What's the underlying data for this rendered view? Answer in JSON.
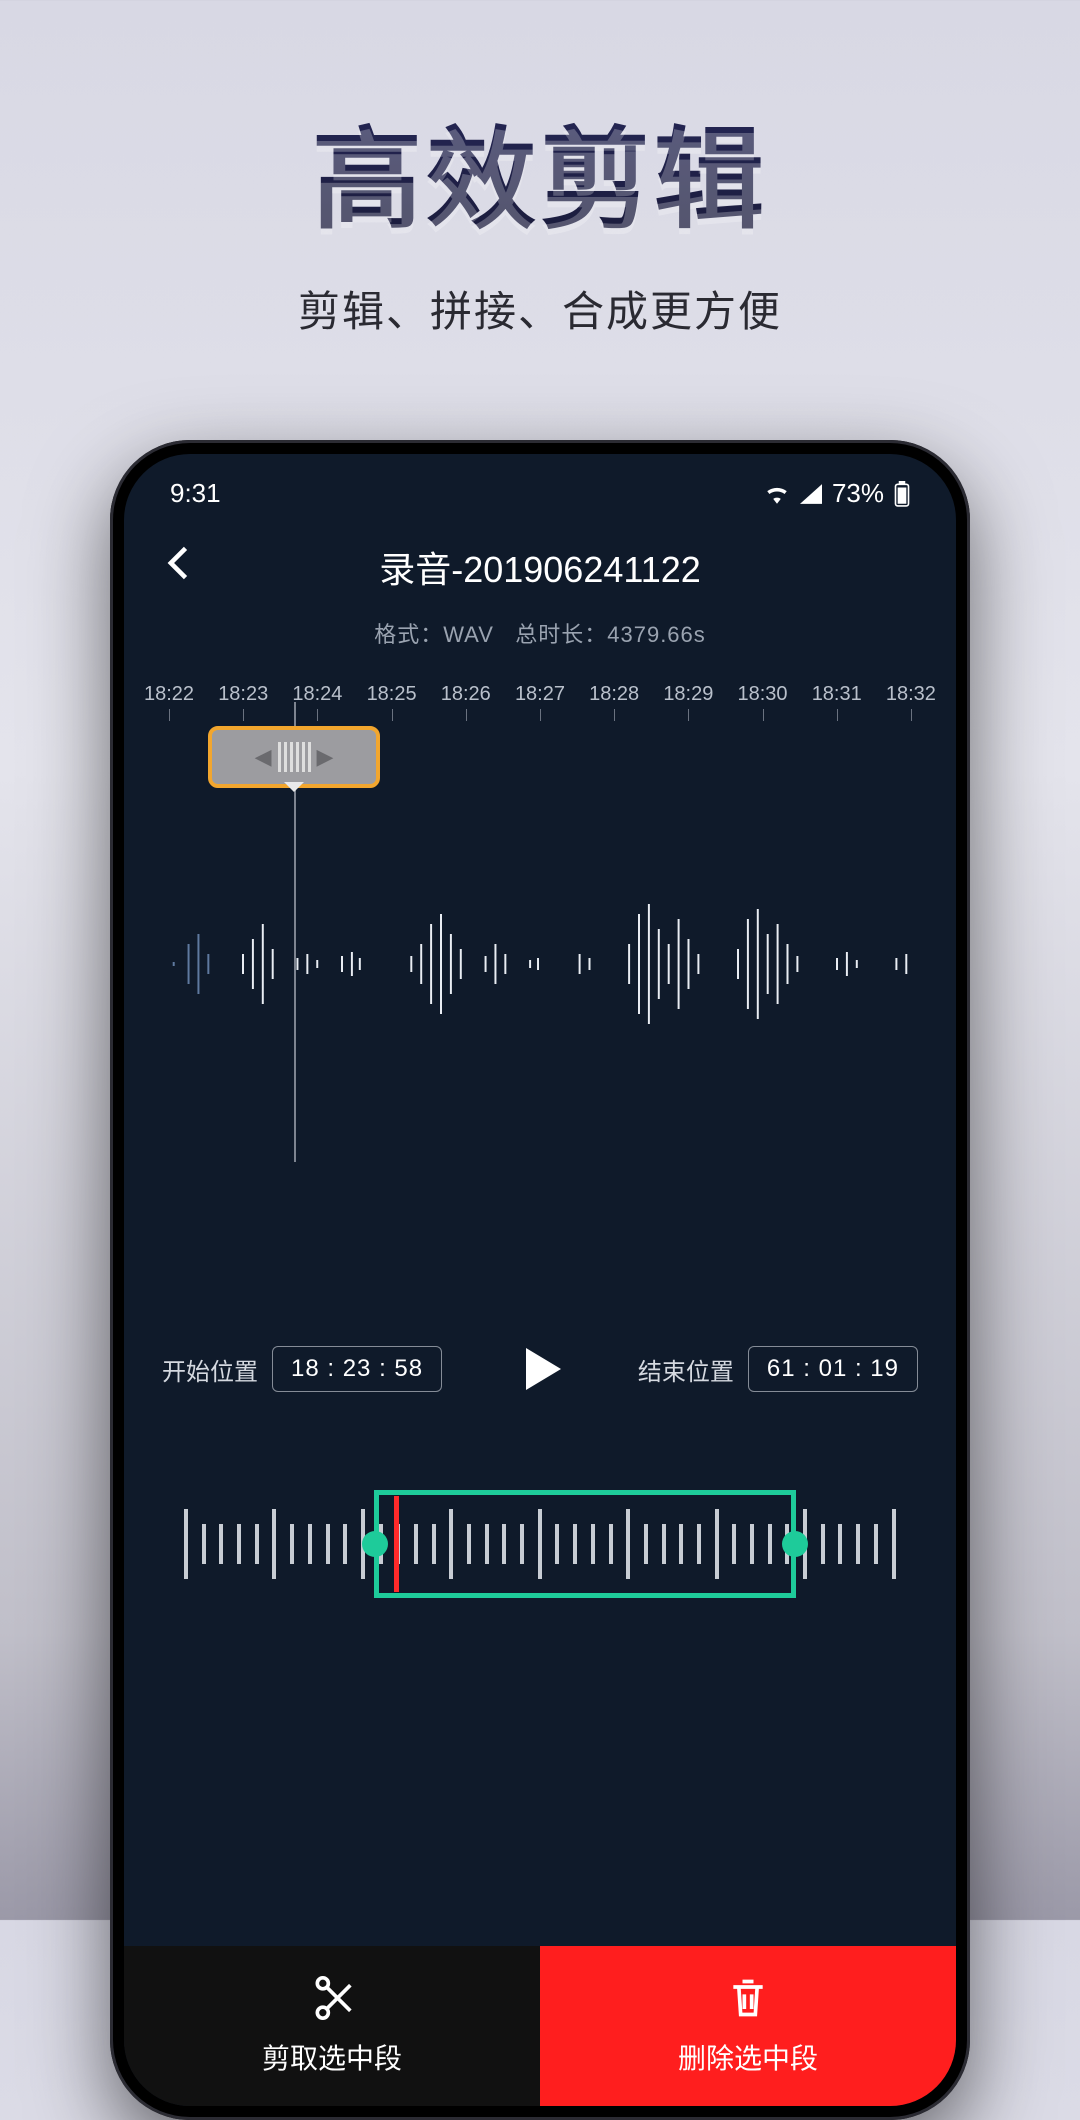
{
  "promo": {
    "title": "高效剪辑",
    "subtitle": "剪辑、拼接、合成更方便"
  },
  "statusbar": {
    "time": "9:31",
    "battery": "73%"
  },
  "header": {
    "title": "录音-201906241122",
    "format_label": "格式：",
    "format_value": "WAV",
    "duration_label": "总时长：",
    "duration_value": "4379.66s"
  },
  "ruler": [
    "18:22",
    "18:23",
    "18:24",
    "18:25",
    "18:26",
    "18:27",
    "18:28",
    "18:29",
    "18:30",
    "18:31",
    "18:32"
  ],
  "controls": {
    "start_label": "开始位置",
    "start_value": "18 : 23 : 58",
    "end_label": "结束位置",
    "end_value": "61 : 01 : 19"
  },
  "actions": {
    "cut": "剪取选中段",
    "delete": "删除选中段"
  },
  "icons": {
    "back": "chevron-left-icon",
    "play": "play-icon",
    "scissors": "scissors-icon",
    "trash": "trash-icon",
    "wifi": "wifi-icon",
    "cell": "cell-signal-icon",
    "battery": "battery-icon"
  }
}
